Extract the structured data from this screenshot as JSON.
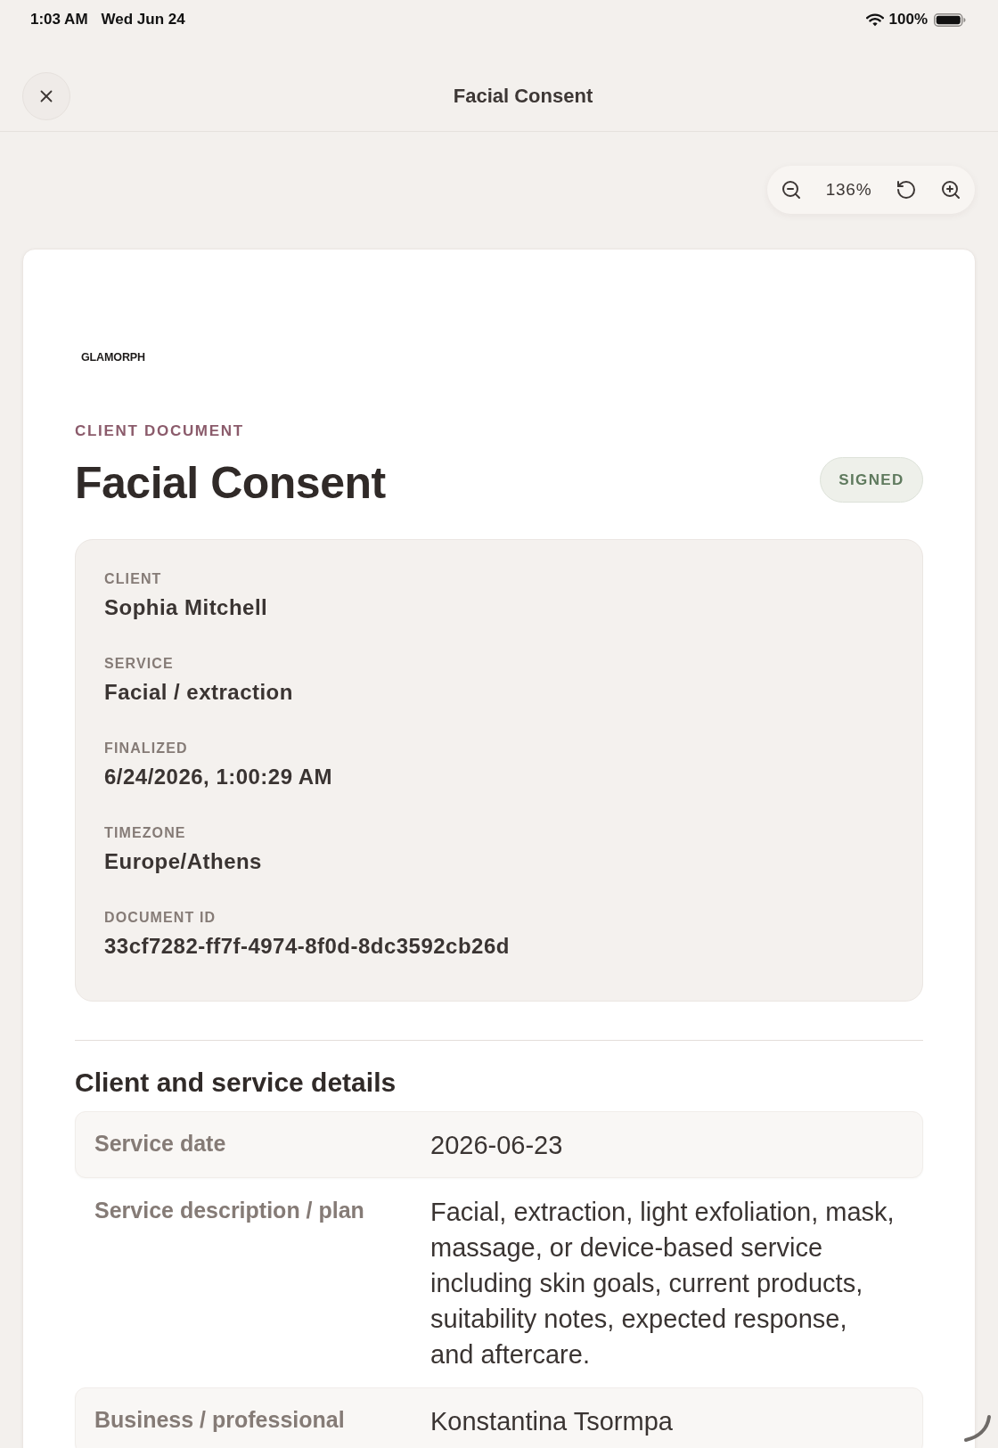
{
  "status_bar": {
    "time": "1:03 AM",
    "date": "Wed Jun 24",
    "battery": "100%"
  },
  "header": {
    "title": "Facial Consent"
  },
  "zoom_controls": {
    "zoom": "136%"
  },
  "document": {
    "logo": "GLAMORPH",
    "eyebrow": "CLIENT DOCUMENT",
    "title": "Facial Consent",
    "badge": "SIGNED",
    "summary": [
      {
        "label": "CLIENT",
        "value": "Sophia Mitchell"
      },
      {
        "label": "SERVICE",
        "value": "Facial / extraction"
      },
      {
        "label": "FINALIZED",
        "value": "6/24/2026, 1:00:29 AM"
      },
      {
        "label": "TIMEZONE",
        "value": "Europe/Athens"
      },
      {
        "label": "DOCUMENT ID",
        "value": "33cf7282-ff7f-4974-8f0d-8dc3592cb26d"
      }
    ],
    "details": {
      "title": "Client and service details",
      "rows": [
        {
          "label": "Service date",
          "value": "2026-06-23"
        },
        {
          "label": "Service description / plan",
          "value": "Facial, extraction, light exfoliation, mask, massage, or device-based service including skin goals, current products, suitability notes, expected response, and aftercare."
        },
        {
          "label": "Business / professional",
          "value": "Konstantina Tsormpa"
        }
      ]
    }
  }
}
